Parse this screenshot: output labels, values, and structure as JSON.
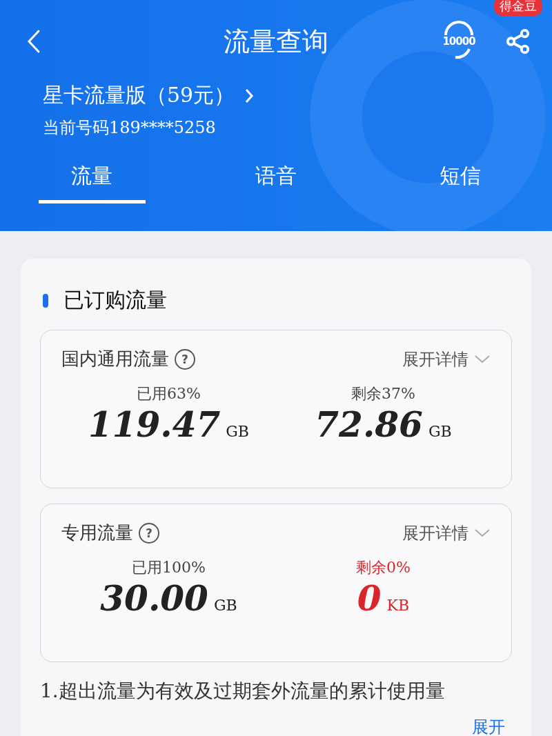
{
  "header": {
    "title": "流量查询",
    "hotline": "10000",
    "badge": "得金豆",
    "plan": "星卡流量版（59元）",
    "phone": "当前号码189****5258"
  },
  "tabs": [
    {
      "label": "流量",
      "selected": true
    },
    {
      "label": "语音",
      "selected": false
    },
    {
      "label": "短信",
      "selected": false
    }
  ],
  "section_title": "已订购流量",
  "packages": [
    {
      "name": "国内通用流量",
      "help": "?",
      "expand": "展开详情",
      "used_label": "已用63%",
      "used_value": "119.47",
      "used_unit": "GB",
      "remain_label": "剩余37%",
      "remain_value": "72.86",
      "remain_unit": "GB",
      "exhausted": false
    },
    {
      "name": "专用流量",
      "help": "?",
      "expand": "展开详情",
      "used_label": "已用100%",
      "used_value": "30.00",
      "used_unit": "GB",
      "remain_label": "剩余0%",
      "remain_value": "0",
      "remain_unit": "KB",
      "exhausted": true
    }
  ],
  "note": "1.超出流量为有效及过期套外流量的累计使用量",
  "note_toggle": "展开"
}
